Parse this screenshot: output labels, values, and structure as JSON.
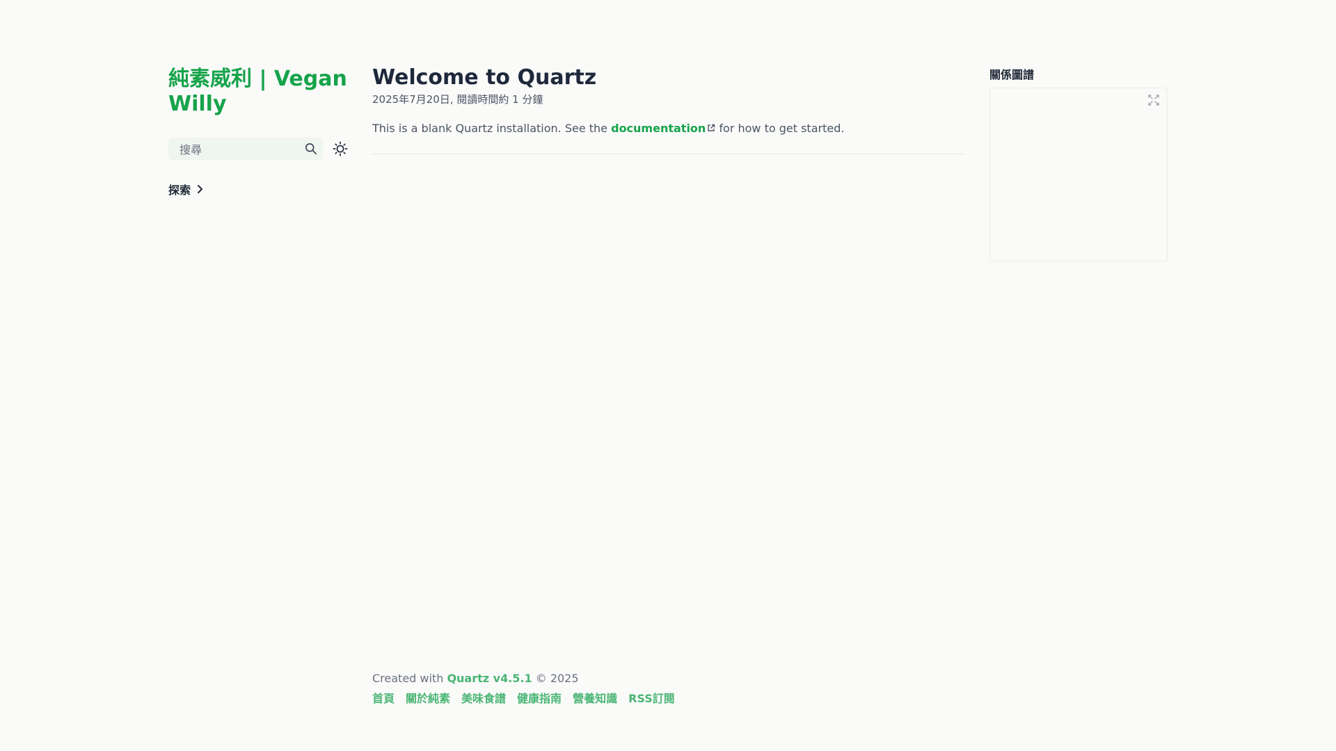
{
  "site": {
    "title": "純素威利 | Vegan Willy"
  },
  "search": {
    "placeholder": "搜尋",
    "icon": "search-icon"
  },
  "darkmode": {
    "icon": "sun-icon"
  },
  "explorer": {
    "label": "探索",
    "icon": "chevron-right-icon"
  },
  "article": {
    "title": "Welcome to Quartz",
    "meta": "2025年7月20日, 閱讀時間約 1 分鐘",
    "body_before": "This is a blank Quartz installation. See the ",
    "link_text": "documentation",
    "link_icon": "external-link-icon",
    "body_after": " for how to get started."
  },
  "graph": {
    "title": "關係圖譜",
    "expand_icon": "fullscreen-icon"
  },
  "footer": {
    "credit_prefix": "Created with ",
    "credit_link": "Quartz v4.5.1",
    "credit_suffix": " © 2025",
    "links": [
      "首頁",
      "關於純素",
      "美味食譜",
      "健康指南",
      "營養知識",
      "RSS訂閱"
    ]
  },
  "colors": {
    "accent": "#16a34a",
    "footer_link": "#4ab574",
    "background": "#fafaf9",
    "search_bg": "#eff5ef"
  }
}
